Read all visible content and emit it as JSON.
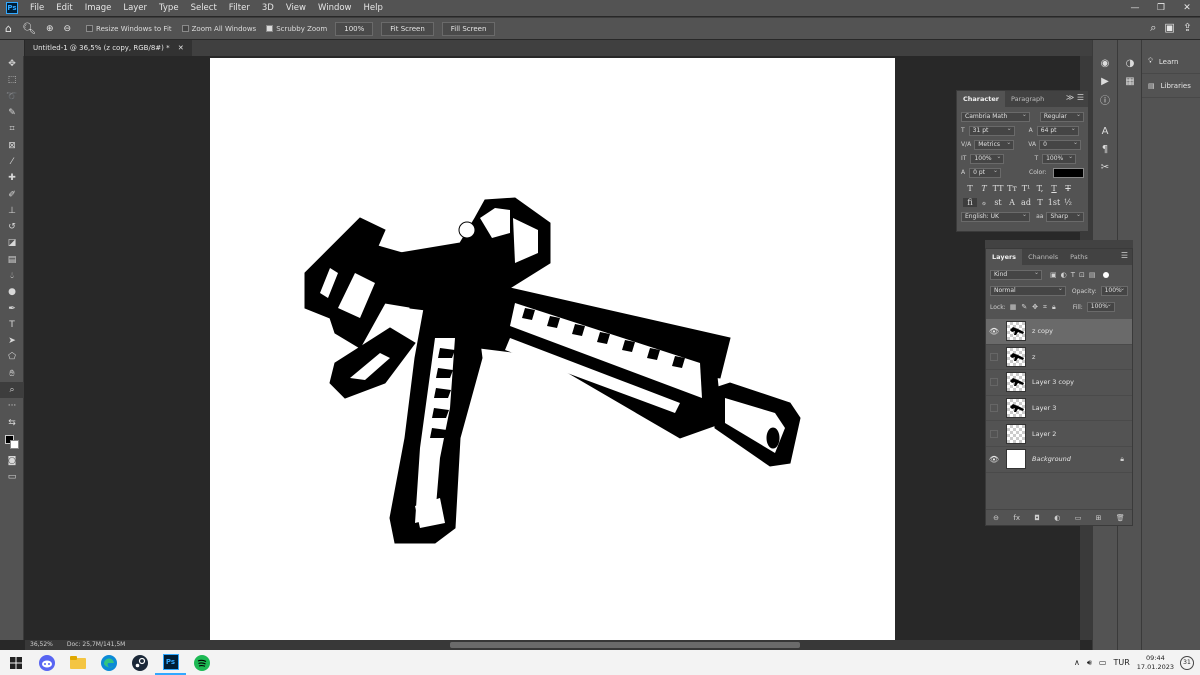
{
  "app": {
    "logo": "Ps"
  },
  "menu": [
    "File",
    "Edit",
    "Image",
    "Layer",
    "Type",
    "Select",
    "Filter",
    "3D",
    "View",
    "Window",
    "Help"
  ],
  "window_controls": [
    "—",
    "❐",
    "✕"
  ],
  "options": {
    "resize_windows": "Resize Windows to Fit",
    "zoom_all": "Zoom All Windows",
    "scrubby_zoom": "Scrubby Zoom",
    "zoom_value": "100%",
    "fit_screen": "Fit Screen",
    "fill_screen": "Fill Screen"
  },
  "document": {
    "tab_title": "Untitled-1 @ 36,5% (z copy, RGB/8#) *",
    "close": "✕"
  },
  "status": {
    "zoom": "36,52%",
    "doc": "Doc: 25,7M/141,5M"
  },
  "tools": [
    "move-icon",
    "marquee-icon",
    "lasso-icon",
    "quick-select-icon",
    "crop-icon",
    "frame-icon",
    "eyedropper-icon",
    "healing-icon",
    "brush-icon",
    "stamp-icon",
    "history-brush-icon",
    "eraser-icon",
    "gradient-icon",
    "blur-icon",
    "dodge-icon",
    "pen-icon",
    "type-icon",
    "path-select-icon",
    "shape-icon",
    "hand-icon",
    "zoom-icon",
    "more-icon"
  ],
  "learn_panel": {
    "learn": "Learn",
    "libraries": "Libraries"
  },
  "character": {
    "tab_character": "Character",
    "tab_paragraph": "Paragraph",
    "font_family": "Cambria Math",
    "font_style": "Regular",
    "font_size": "31 pt",
    "leading": "64 pt",
    "kerning": "Metrics",
    "tracking": "0",
    "vertical_scale": "100%",
    "horizontal_scale": "100%",
    "baseline_shift": "0 pt",
    "color_label": "Color:",
    "text_color": "#000000",
    "glyph_row1": [
      "T",
      "T",
      "TT",
      "Tт",
      "T¹",
      "T,",
      "T",
      "T"
    ],
    "glyph_row2": [
      "fi",
      "ℴ",
      "st",
      "A",
      "ad",
      "T",
      "1st",
      "½"
    ],
    "language": "English: UK",
    "antialias": "Sharp",
    "aa_label": "aa"
  },
  "layers": {
    "tab_layers": "Layers",
    "tab_channels": "Channels",
    "tab_paths": "Paths",
    "kind": "Kind",
    "blend_mode": "Normal",
    "opacity_label": "Opacity:",
    "opacity": "100%",
    "lock_label": "Lock:",
    "fill_label": "Fill:",
    "fill": "100%",
    "items": [
      {
        "name": "z copy",
        "visible": true,
        "selected": true
      },
      {
        "name": "z",
        "visible": false,
        "selected": false
      },
      {
        "name": "Layer 3 copy",
        "visible": false,
        "selected": false
      },
      {
        "name": "Layer 3",
        "visible": false,
        "selected": false
      },
      {
        "name": "Layer 2",
        "visible": false,
        "selected": false
      },
      {
        "name": "Background",
        "visible": true,
        "selected": false
      }
    ],
    "footer": [
      "⊖",
      "fx",
      "◘",
      "◐",
      "▭",
      "⊞",
      "🗑"
    ]
  },
  "taskbar": {
    "apps": [
      "windows-icon",
      "discord-icon",
      "explorer-icon",
      "edge-icon",
      "steam-icon",
      "photoshop-icon",
      "spotify-icon"
    ],
    "tray_chevron": "∧",
    "language": "TUR",
    "time": "09:44",
    "date": "17.01.2023",
    "notifications": "31"
  }
}
